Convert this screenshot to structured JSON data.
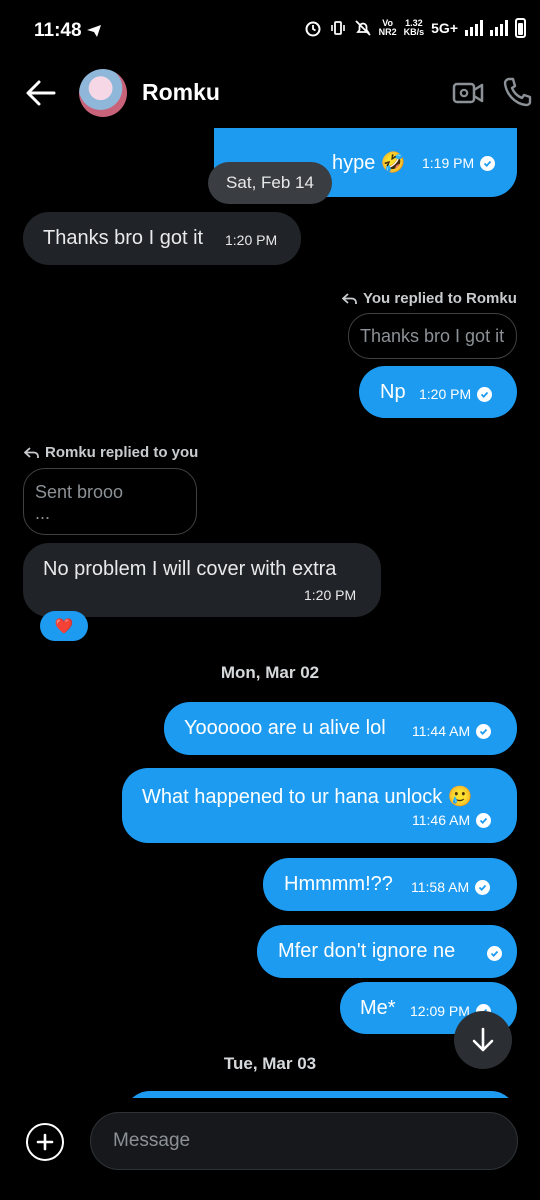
{
  "status_bar": {
    "time": "11:48",
    "speed_value": "1.32",
    "speed_unit": "KB/s",
    "volte_top": "Vo",
    "volte_bottom": "NR2",
    "network": "5G+"
  },
  "header": {
    "contact_name": "Romku",
    "icons": [
      "back-arrow-icon",
      "avatar",
      "video-call-icon",
      "phone-icon"
    ]
  },
  "chat": {
    "clipped_top_text": "hype 🤣",
    "clipped_top_time": "1:19 PM",
    "floating_date": "Sat, Feb 14",
    "messages": [
      {
        "text": "Thanks bro I got it",
        "time": "1:20 PM"
      },
      {
        "reply_label": "You replied to Romku",
        "quote": "Thanks bro I got it",
        "text": "Np",
        "time": "1:20 PM"
      },
      {
        "reply_label": "Romku replied to you",
        "quote": "Sent brooo",
        "quote_more": "...",
        "text": "No problem I will cover with extra",
        "time": "1:20 PM",
        "reaction": "❤️"
      }
    ],
    "date_mar02": "Mon, Mar 02",
    "messages_mar02": [
      {
        "text": "Yoooooo are u alive lol",
        "time": "11:44 AM"
      },
      {
        "text": "What happened to ur hana unlock 🥲",
        "time": "11:46 AM"
      },
      {
        "text": "Hmmmm!??",
        "time": "11:58 AM"
      },
      {
        "text": "Mfer don't ignore ne",
        "time": ""
      },
      {
        "text": "Me*",
        "time": "12:09 PM"
      }
    ],
    "date_mar03": "Tue, Mar 03"
  },
  "composer": {
    "placeholder": "Message"
  },
  "colors": {
    "accent": "#1d9bf0",
    "incoming_bubble": "#202327",
    "background": "#000000"
  }
}
